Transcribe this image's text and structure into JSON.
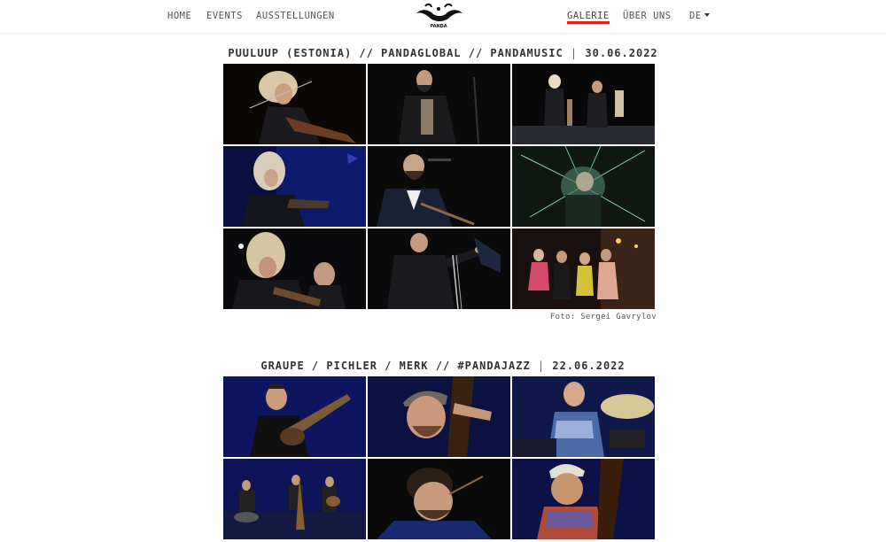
{
  "nav": {
    "home": "HOME",
    "events": "EVENTS",
    "ausstellungen": "AUSSTELLUNGEN",
    "galerie": "GALERIE",
    "ueber_uns": "ÜBER UNS",
    "lang": "DE"
  },
  "logo": {
    "text": "PANDA"
  },
  "galleries": [
    {
      "title_main": "PUULUUP (ESTONIA) // PANDAGLOBAL // PANDAMUSIC",
      "title_sep": "|",
      "title_date": "30.06.2022",
      "credit": "Foto: Sergei Gavrylov"
    },
    {
      "title_main": "GRAUPE / PICHLER / MERK // #PANDAJAZZ",
      "title_sep": "|",
      "title_date": "22.06.2022"
    }
  ],
  "colors": {
    "accent": "#e2231a",
    "photo_dark": "#0a0a0a",
    "photo_blue": "#0d1460"
  }
}
